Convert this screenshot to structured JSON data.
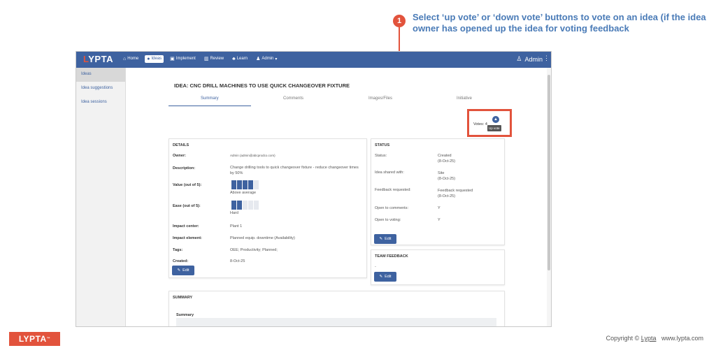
{
  "callout": {
    "number": "1",
    "text": "Select ‘up vote’ or ‘down vote’ buttons to vote on an idea (if the idea owner has opened up the idea for voting feedback"
  },
  "topbar": {
    "logo": "LYPTA",
    "nav": [
      {
        "label": "Home",
        "icon": "home-icon"
      },
      {
        "label": "Ideas",
        "icon": "lightbulb-icon",
        "active": true
      },
      {
        "label": "Implement",
        "icon": "implement-icon"
      },
      {
        "label": "Review",
        "icon": "review-icon"
      },
      {
        "label": "Learn",
        "icon": "learn-icon"
      },
      {
        "label": "Admin",
        "icon": "admin-icon"
      }
    ],
    "user": "Admin"
  },
  "sidebar": {
    "items": [
      {
        "label": "Ideas",
        "active": true
      },
      {
        "label": "Idea suggestions"
      },
      {
        "label": "Idea sessions"
      }
    ]
  },
  "idea": {
    "title": "IDEA: CNC DRILL MACHINES TO USE QUICK CHANGEOVER FIXTURE"
  },
  "tabs": [
    "Summary",
    "Comments",
    "Images/Files",
    "Initiative"
  ],
  "votes": {
    "label": "Votes: 4",
    "tooltip": "Up vote"
  },
  "details": {
    "title": "DETAILS",
    "owner_label": "Owner:",
    "owner_value": "Admin (admin@abcprodco.com)",
    "description_label": "Description:",
    "description_value": "Change drilling tools to quick changeover fixture - reduce changeover times by 50%",
    "value_label": "Value (out of 5):",
    "value_score": 4,
    "value_text": "Above average",
    "ease_label": "Ease (out of 5):",
    "ease_score": 2,
    "ease_text": "Hard",
    "impact_center_label": "Impact center:",
    "impact_center_value": "Plant 1",
    "impact_element_label": "Impact element:",
    "impact_element_value": "Planned equip. downtime (Availability)",
    "tags_label": "Tags:",
    "tags_value": "OEE; Productivity; Planned;",
    "created_label": "Created:",
    "created_value": "8-Oct-25",
    "edit": "Edit"
  },
  "status": {
    "title": "STATUS",
    "rows": [
      {
        "label": "Status:",
        "value": "Created",
        "sub": "(8-Oct-25)"
      },
      {
        "label": "Idea shared with:",
        "value": "Site",
        "sub": "(8-Oct-25)"
      },
      {
        "label": "Feedback requested:",
        "value": "Feedback requested",
        "sub": "(8-Oct-25)"
      },
      {
        "label": "Open to comments:",
        "value": "Y",
        "sub": ""
      },
      {
        "label": "Open to voting:",
        "value": "Y",
        "sub": ""
      }
    ],
    "edit": "Edit"
  },
  "team_feedback": {
    "title": "TEAM FEEDBACK",
    "value": "-",
    "edit": "Edit"
  },
  "summary": {
    "title": "SUMMARY",
    "sub": "Summary"
  },
  "footer": {
    "logo": "LYPTA",
    "tm": "™",
    "copyright_prefix": "Copyright © ",
    "copyright_link": "Lypta",
    "copyright_site": "   www.lypta.com"
  },
  "colors": {
    "brand_blue": "#3e62a0",
    "accent_red": "#e2533c",
    "callout_text": "#4a7bb7"
  }
}
